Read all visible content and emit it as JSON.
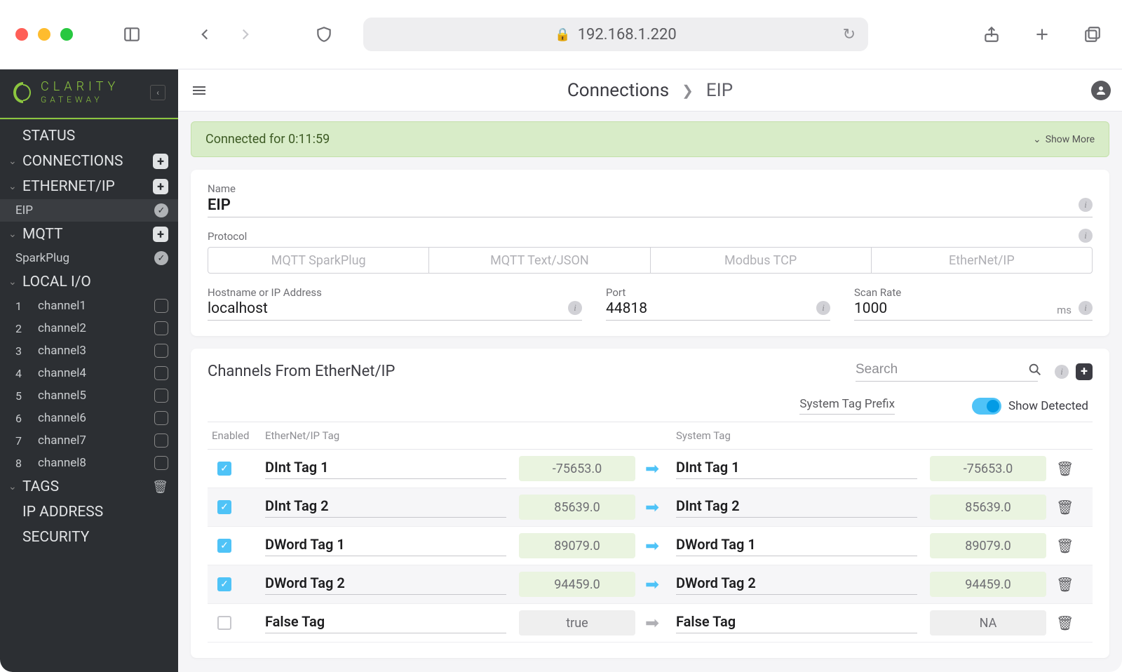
{
  "browser": {
    "url": "192.168.1.220"
  },
  "brand": {
    "line1": "CLARITY",
    "line2": "GATEWAY"
  },
  "sidebar": {
    "status": "STATUS",
    "connections": "CONNECTIONS",
    "ethernetip": "ETHERNET/IP",
    "eip": "EIP",
    "mqtt": "MQTT",
    "sparkplug": "SparkPlug",
    "localio": "LOCAL I/O",
    "channels": [
      {
        "num": "1",
        "label": "channel1"
      },
      {
        "num": "2",
        "label": "channel2"
      },
      {
        "num": "3",
        "label": "channel3"
      },
      {
        "num": "4",
        "label": "channel4"
      },
      {
        "num": "5",
        "label": "channel5"
      },
      {
        "num": "6",
        "label": "channel6"
      },
      {
        "num": "7",
        "label": "channel7"
      },
      {
        "num": "8",
        "label": "channel8"
      }
    ],
    "tags": "TAGS",
    "ipaddress": "IP ADDRESS",
    "security": "SECURITY"
  },
  "header": {
    "crumb1": "Connections",
    "crumb2": "EIP"
  },
  "status_banner": {
    "text": "Connected for 0:11:59",
    "more": "Show More"
  },
  "config": {
    "name_label": "Name",
    "name_value": "EIP",
    "protocol_label": "Protocol",
    "proto_tabs": [
      "MQTT SparkPlug",
      "MQTT Text/JSON",
      "Modbus TCP",
      "EtherNet/IP"
    ],
    "host_label": "Hostname or IP Address",
    "host_value": "localhost",
    "port_label": "Port",
    "port_value": "44818",
    "scan_label": "Scan Rate",
    "scan_value": "1000",
    "scan_unit": "ms"
  },
  "channels": {
    "title": "Channels From EtherNet/IP",
    "search_placeholder": "Search",
    "prefix_label": "System Tag Prefix",
    "show_detected": "Show Detected",
    "head": {
      "enabled": "Enabled",
      "ethtag": "EtherNet/IP Tag",
      "systag": "System Tag"
    },
    "rows": [
      {
        "enabled": true,
        "ethtag": "DInt Tag 1",
        "ethval": "-75653.0",
        "systag": "DInt Tag 1",
        "sysval": "-75653.0",
        "active": true
      },
      {
        "enabled": true,
        "ethtag": "DInt Tag 2",
        "ethval": "85639.0",
        "systag": "DInt Tag 2",
        "sysval": "85639.0",
        "active": true
      },
      {
        "enabled": true,
        "ethtag": "DWord Tag 1",
        "ethval": "89079.0",
        "systag": "DWord Tag 1",
        "sysval": "89079.0",
        "active": true
      },
      {
        "enabled": true,
        "ethtag": "DWord Tag 2",
        "ethval": "94459.0",
        "systag": "DWord Tag 2",
        "sysval": "94459.0",
        "active": true
      },
      {
        "enabled": false,
        "ethtag": "False Tag",
        "ethval": "true",
        "systag": "False Tag",
        "sysval": "NA",
        "active": false
      }
    ]
  }
}
